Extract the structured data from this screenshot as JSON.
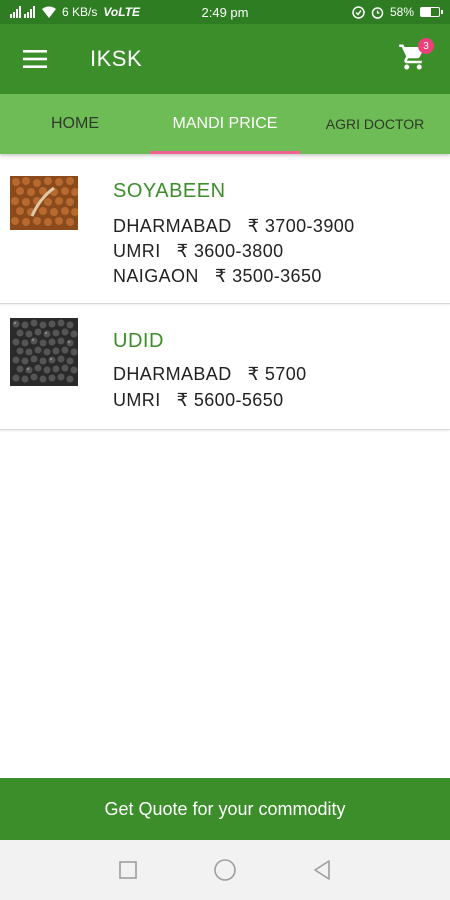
{
  "status_bar": {
    "network_speed": "6 KB/s",
    "volte": "VoLTE",
    "time": "2:49 pm",
    "battery": "58%",
    "battery_level": 0.58
  },
  "app_bar": {
    "title": "IKSK",
    "cart_count": "3",
    "menu_icon": "hamburger-menu-icon",
    "cart_icon": "shopping-cart-icon"
  },
  "tabs": [
    {
      "label": "HOME",
      "active": false
    },
    {
      "label": "MANDI PRICE",
      "active": true
    },
    {
      "label": "AGRI DOCTOR",
      "active": false
    }
  ],
  "crops": [
    {
      "name": "SOYABEEN",
      "image": "soyabean-seeds-image",
      "prices": [
        {
          "market": "DHARMABAD",
          "price": "₹ 3700-3900"
        },
        {
          "market": "UMRI",
          "price": "₹ 3600-3800"
        },
        {
          "market": "NAIGAON",
          "price": "₹ 3500-3650"
        }
      ]
    },
    {
      "name": "UDID",
      "image": "udid-seeds-image",
      "prices": [
        {
          "market": "DHARMABAD",
          "price": "₹ 5700"
        },
        {
          "market": "UMRI",
          "price": "₹ 5600-5650"
        }
      ]
    }
  ],
  "quote_bar": {
    "label": "Get Quote for your commodity"
  },
  "colors": {
    "primary": "#3b8e2a",
    "status_bar": "#2e7d22",
    "tab_bar": "#6ebc55",
    "tab_indicator": "#f06292",
    "badge": "#ec407a"
  }
}
